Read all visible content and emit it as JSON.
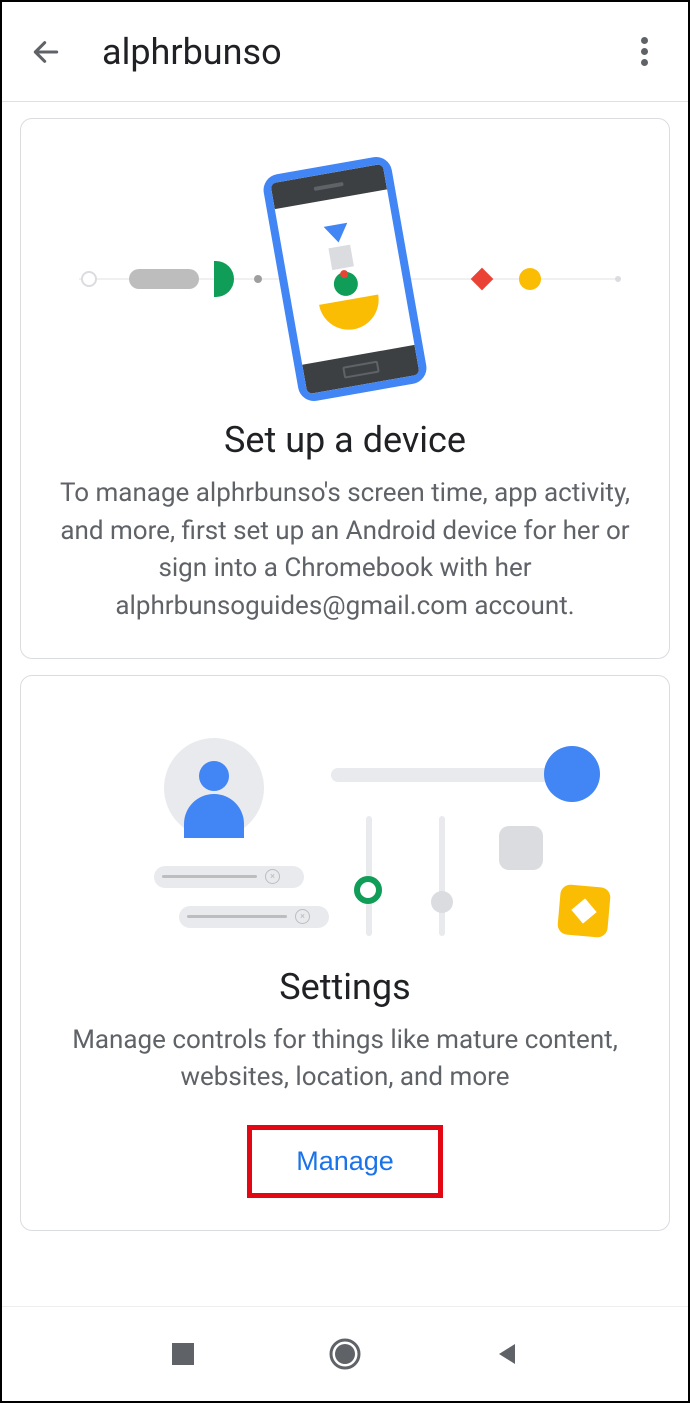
{
  "header": {
    "title": "alphrbunso"
  },
  "card_setup": {
    "title": "Set up a device",
    "description": "To manage alphrbunso's screen time, app activity, and more, first set up an Android device for her or sign into a Chromebook with her alphrbunsoguides@gmail.com account."
  },
  "card_settings": {
    "title": "Settings",
    "description": "Manage controls for things like mature content, websites, location, and more",
    "button_label": "Manage"
  }
}
